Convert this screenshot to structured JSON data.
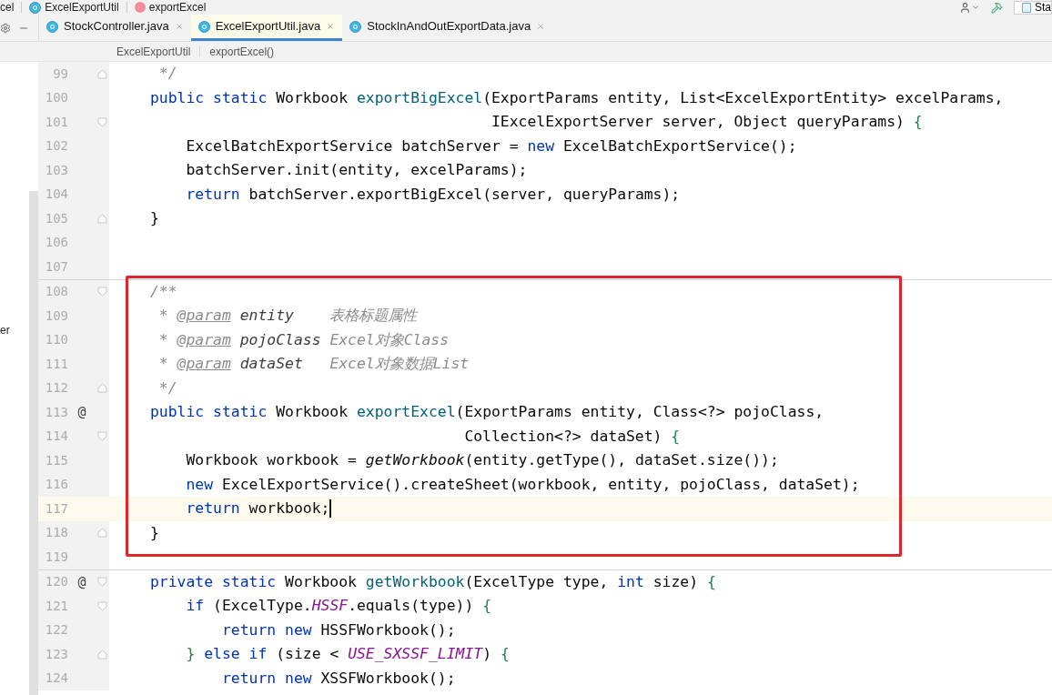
{
  "nav_bar": {
    "items": [
      {
        "text": "cel",
        "kind": "plain"
      },
      {
        "text": "ExcelExportUtil",
        "kind": "class"
      },
      {
        "text": "exportExcel",
        "kind": "method"
      }
    ],
    "run_config": "Sta"
  },
  "tabs": [
    {
      "label": "StockController.java",
      "selected": false
    },
    {
      "label": "ExcelExportUtil.java",
      "selected": true
    },
    {
      "label": "StockInAndOutExportData.java",
      "selected": false
    }
  ],
  "breadcrumb": [
    "ExcelExportUtil",
    "exportExcel()"
  ],
  "side_panel": {
    "text": "er"
  },
  "editor": {
    "blocks": [
      {
        "boxed": false,
        "separator_above": false,
        "lines": [
          {
            "number": "99",
            "fold_start": false,
            "fold_end": true,
            "current": false,
            "tokens": [
              {
                "kind": "comment",
                "text": " */"
              }
            ]
          },
          {
            "number": "100",
            "fold_start": false,
            "fold_end": false,
            "current": false,
            "tokens": [
              {
                "kind": "kw",
                "text": "public static "
              },
              {
                "kind": "plain",
                "text": "Workbook "
              },
              {
                "kind": "fn",
                "text": "exportBigExcel"
              },
              {
                "kind": "plain",
                "text": "(ExportParams entity, List<ExcelExportEntity> excelParams,"
              }
            ]
          },
          {
            "number": "101",
            "fold_start": true,
            "fold_end": false,
            "current": false,
            "tokens": [
              {
                "kind": "plain",
                "text": "                                      IExcelExportServer server, Object queryParams) "
              },
              {
                "kind": "brace",
                "text": "{"
              }
            ]
          },
          {
            "number": "102",
            "fold_start": false,
            "fold_end": false,
            "current": false,
            "tokens": [
              {
                "kind": "plain",
                "text": "    ExcelBatchExportService batchServer = "
              },
              {
                "kind": "kw",
                "text": "new "
              },
              {
                "kind": "plain",
                "text": "ExcelBatchExportService();"
              }
            ]
          },
          {
            "number": "103",
            "fold_start": false,
            "fold_end": false,
            "current": false,
            "tokens": [
              {
                "kind": "plain",
                "text": "    batchServer.init(entity, excelParams);"
              }
            ]
          },
          {
            "number": "104",
            "fold_start": false,
            "fold_end": false,
            "current": false,
            "tokens": [
              {
                "kind": "kw",
                "text": "    return "
              },
              {
                "kind": "plain",
                "text": "batchServer.exportBigExcel(server, queryParams);"
              }
            ]
          },
          {
            "number": "105",
            "fold_start": false,
            "fold_end": true,
            "current": false,
            "tokens": [
              {
                "kind": "plain",
                "text": "}"
              }
            ]
          },
          {
            "number": "106",
            "fold_start": false,
            "fold_end": false,
            "current": false
          },
          {
            "number": "107",
            "fold_start": false,
            "fold_end": false,
            "current": false
          }
        ]
      },
      {
        "boxed": true,
        "separator_above": true,
        "lines": [
          {
            "number": "108",
            "fold_start": true,
            "fold_end": false,
            "current": false,
            "tokens": [
              {
                "kind": "comment",
                "text": "/**"
              }
            ]
          },
          {
            "number": "109",
            "fold_start": false,
            "fold_end": false,
            "current": false,
            "tokens": [
              {
                "kind": "comment",
                "text": " * "
              },
              {
                "kind": "doctag",
                "text": "@param"
              },
              {
                "kind": "docparam",
                "text": " entity"
              },
              {
                "kind": "comment",
                "text": "    表格标题属性"
              }
            ]
          },
          {
            "number": "110",
            "fold_start": false,
            "fold_end": false,
            "current": false,
            "tokens": [
              {
                "kind": "comment",
                "text": " * "
              },
              {
                "kind": "doctag",
                "text": "@param"
              },
              {
                "kind": "docparam",
                "text": " pojoClass"
              },
              {
                "kind": "comment",
                "text": " Excel对象Class"
              }
            ]
          },
          {
            "number": "111",
            "fold_start": false,
            "fold_end": false,
            "current": false,
            "tokens": [
              {
                "kind": "comment",
                "text": " * "
              },
              {
                "kind": "doctag",
                "text": "@param"
              },
              {
                "kind": "docparam",
                "text": " dataSet"
              },
              {
                "kind": "comment",
                "text": "   Excel对象数据List"
              }
            ]
          },
          {
            "number": "112",
            "fold_start": false,
            "fold_end": true,
            "current": false,
            "tokens": [
              {
                "kind": "comment",
                "text": " */"
              }
            ]
          },
          {
            "number": "113",
            "marker": "@",
            "fold_start": false,
            "fold_end": false,
            "current": false,
            "tokens": [
              {
                "kind": "kw",
                "text": "public static "
              },
              {
                "kind": "plain",
                "text": "Workbook "
              },
              {
                "kind": "fn",
                "text": "exportExcel"
              },
              {
                "kind": "plain",
                "text": "(ExportParams entity, Class<?> pojoClass,"
              }
            ]
          },
          {
            "number": "114",
            "fold_start": true,
            "fold_end": false,
            "current": false,
            "tokens": [
              {
                "kind": "plain",
                "text": "                                   Collection<?> dataSet) "
              },
              {
                "kind": "brace",
                "text": "{"
              }
            ]
          },
          {
            "number": "115",
            "fold_start": false,
            "fold_end": false,
            "current": false,
            "tokens": [
              {
                "kind": "plain",
                "text": "    Workbook workbook = "
              },
              {
                "kind": "call",
                "text": "getWorkbook"
              },
              {
                "kind": "plain",
                "text": "(entity.getType(), dataSet.size());"
              }
            ]
          },
          {
            "number": "116",
            "fold_start": false,
            "fold_end": false,
            "current": false,
            "tokens": [
              {
                "kind": "kw",
                "text": "    new "
              },
              {
                "kind": "plain",
                "text": "ExcelExportService().createSheet(workbook, entity, pojoClass, dataSet);"
              }
            ]
          },
          {
            "number": "117",
            "fold_start": false,
            "fold_end": false,
            "current": true,
            "tokens": [
              {
                "kind": "kw",
                "text": "    return "
              },
              {
                "kind": "plain",
                "text": "workbook;"
              }
            ]
          },
          {
            "number": "118",
            "fold_start": false,
            "fold_end": true,
            "current": false,
            "tokens": [
              {
                "kind": "plain",
                "text": "}"
              }
            ]
          },
          {
            "number": "119",
            "fold_start": false,
            "fold_end": false,
            "current": false
          }
        ]
      },
      {
        "boxed": false,
        "separator_above": true,
        "lines": [
          {
            "number": "120",
            "marker": "@",
            "fold_start": true,
            "fold_end": false,
            "current": false,
            "tokens": [
              {
                "kind": "kw",
                "text": "private static "
              },
              {
                "kind": "plain",
                "text": "Workbook "
              },
              {
                "kind": "fn",
                "text": "getWorkbook"
              },
              {
                "kind": "plain",
                "text": "(ExcelType type, "
              },
              {
                "kind": "kw",
                "text": "int "
              },
              {
                "kind": "plain",
                "text": "size) "
              },
              {
                "kind": "brace",
                "text": "{"
              }
            ]
          },
          {
            "number": "121",
            "fold_start": true,
            "fold_end": false,
            "current": false,
            "tokens": [
              {
                "kind": "kw",
                "text": "    if "
              },
              {
                "kind": "plain",
                "text": "(ExcelType."
              },
              {
                "kind": "field",
                "text": "HSSF"
              },
              {
                "kind": "plain",
                "text": ".equals(type)) "
              },
              {
                "kind": "brace",
                "text": "{"
              }
            ]
          },
          {
            "number": "122",
            "fold_start": false,
            "fold_end": false,
            "current": false,
            "tokens": [
              {
                "kind": "kw",
                "text": "        return new "
              },
              {
                "kind": "plain",
                "text": "HSSFWorkbook();"
              }
            ]
          },
          {
            "number": "123",
            "fold_start": false,
            "fold_end": true,
            "current": false,
            "tokens": [
              {
                "kind": "brace",
                "text": "    } "
              },
              {
                "kind": "kw",
                "text": "else if "
              },
              {
                "kind": "plain",
                "text": "(size < "
              },
              {
                "kind": "field",
                "text": "USE_SXSSF_LIMIT"
              },
              {
                "kind": "plain",
                "text": ") "
              },
              {
                "kind": "brace",
                "text": "{"
              }
            ]
          },
          {
            "number": "124",
            "fold_start": false,
            "fold_end": false,
            "current": false,
            "tokens": [
              {
                "kind": "kw",
                "text": "        return new "
              },
              {
                "kind": "plain",
                "text": "XSSFWorkbook();"
              }
            ]
          }
        ]
      }
    ]
  }
}
